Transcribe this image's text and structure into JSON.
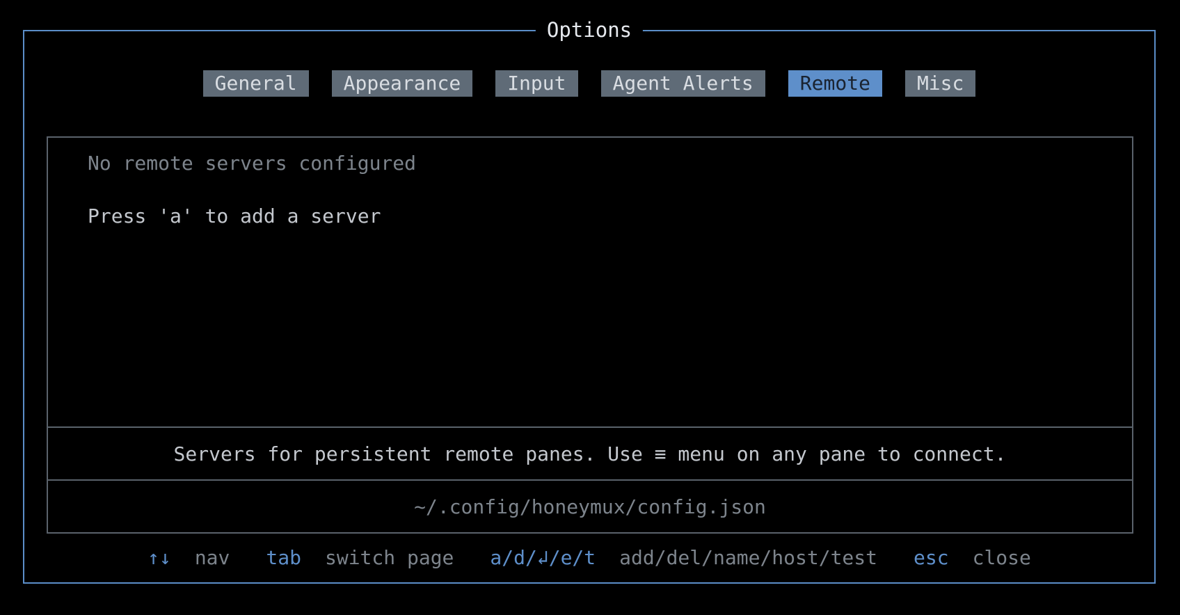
{
  "dialog": {
    "title": "Options"
  },
  "tabs": [
    {
      "label": "General",
      "active": false
    },
    {
      "label": "Appearance",
      "active": false
    },
    {
      "label": "Input",
      "active": false
    },
    {
      "label": "Agent Alerts",
      "active": false
    },
    {
      "label": "Remote",
      "active": true
    },
    {
      "label": "Misc",
      "active": false
    }
  ],
  "remote": {
    "empty_message": "No remote servers configured",
    "add_hint": "Press 'a' to add a server",
    "description": "Servers for persistent remote panes. Use ≡ menu on any pane to connect.",
    "config_path": "~/.config/honeymux/config.json"
  },
  "keybar": [
    {
      "key": "↑↓",
      "desc": "nav"
    },
    {
      "key": "tab",
      "desc": "switch page"
    },
    {
      "key": "a/d/↲/e/t",
      "desc": "add/del/name/host/test"
    },
    {
      "key": "esc",
      "desc": "close"
    }
  ],
  "colors": {
    "accent": "#5e8fca",
    "border": "#5b8ec9",
    "tab_inactive": "#5f6b77",
    "muted_text": "#7d848c",
    "text": "#c4c8ce",
    "background": "#000000"
  }
}
